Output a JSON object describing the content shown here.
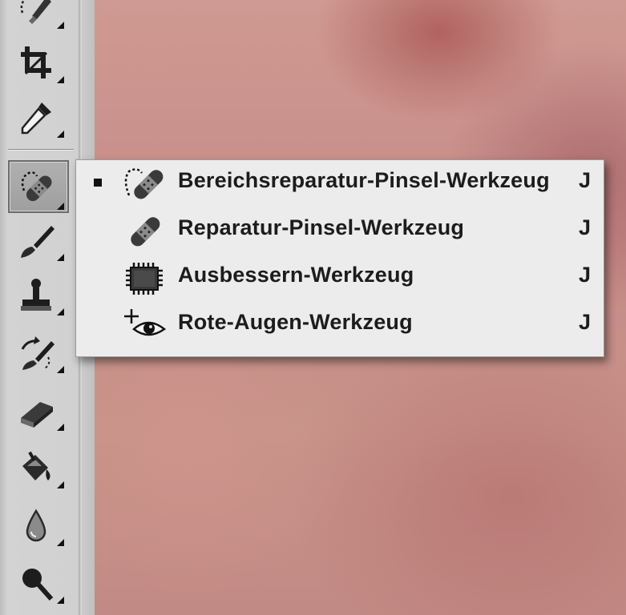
{
  "toolbar": {
    "tools": [
      {
        "name": "quick-selection-tool",
        "icon": "quick-selection-icon"
      },
      {
        "name": "crop-tool",
        "icon": "crop-icon"
      },
      {
        "name": "eyedropper-tool",
        "icon": "eyedropper-icon"
      },
      {
        "name": "spot-healing-brush-tool",
        "icon": "spot-healing-brush-icon",
        "active": true
      },
      {
        "name": "brush-tool",
        "icon": "brush-icon"
      },
      {
        "name": "clone-stamp-tool",
        "icon": "clone-stamp-icon"
      },
      {
        "name": "history-brush-tool",
        "icon": "history-brush-icon"
      },
      {
        "name": "eraser-tool",
        "icon": "eraser-icon"
      },
      {
        "name": "paint-bucket-tool",
        "icon": "paint-bucket-icon"
      },
      {
        "name": "blur-tool",
        "icon": "blur-drop-icon"
      },
      {
        "name": "dodge-tool",
        "icon": "dodge-icon"
      }
    ]
  },
  "flyout": {
    "items": [
      {
        "label": "Bereichsreparatur-Pinsel-Werkzeug",
        "shortcut": "J",
        "selected": true,
        "icon": "spot-healing-brush-icon"
      },
      {
        "label": "Reparatur-Pinsel-Werkzeug",
        "shortcut": "J",
        "selected": false,
        "icon": "healing-brush-icon"
      },
      {
        "label": "Ausbessern-Werkzeug",
        "shortcut": "J",
        "selected": false,
        "icon": "patch-icon"
      },
      {
        "label": "Rote-Augen-Werkzeug",
        "shortcut": "J",
        "selected": false,
        "icon": "red-eye-icon"
      }
    ]
  },
  "colors": {
    "menu_bg": "#ececec",
    "text": "#1c1c1c",
    "toolbar_bg": "#d1d1d1",
    "canvas_skin": "#c68b87"
  }
}
